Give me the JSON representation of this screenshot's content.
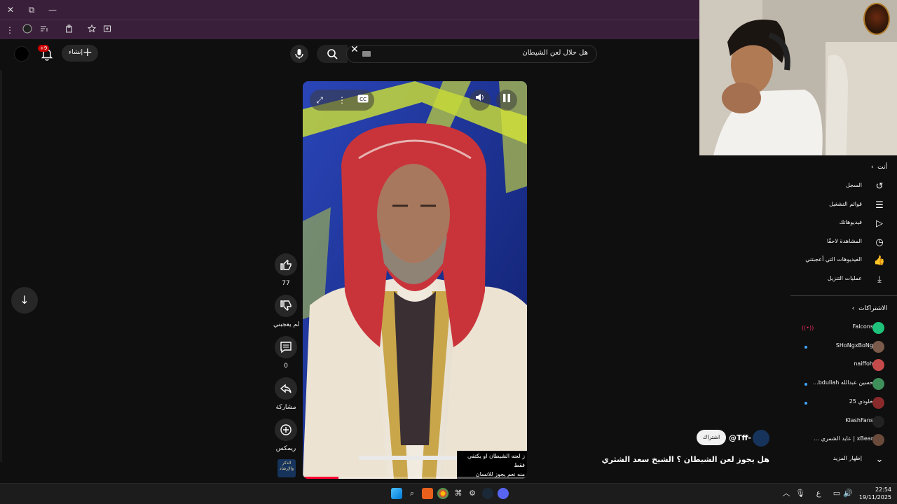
{
  "browser": {
    "close_glyph": "✕",
    "restore_glyph": "⧉",
    "minimize_glyph": "—",
    "menu_glyph": "⋮",
    "icons": [
      "close-icon",
      "restore-icon",
      "minimize-icon",
      "menu-icon",
      "profile-icon",
      "reading-list-icon",
      "extensions-icon",
      "bookmark-star-icon",
      "install-app-icon"
    ]
  },
  "header": {
    "search_query": "هل حلال لعن الشيطان",
    "create_label": "إنشاء",
    "notifications_badge": "+9"
  },
  "video": {
    "caption_lines": [
      "ز لعنه الشيطان او يكتفي فقط",
      "منه نعم يجوز للانسان"
    ],
    "progress": 0.16,
    "accent_color": "#ff0033"
  },
  "actions": {
    "likes": "77",
    "dislike_label": "لم يعجبني",
    "comments": "0",
    "share_label": "مشاركة",
    "remix_label": "ريمكس"
  },
  "channel": {
    "handle": "@Tff-",
    "subscribe_label": "اشتراك",
    "thumb_text": "الذكر والإرشاد"
  },
  "video_title": "هل يجوز لعن الشيطان ؟ الشيخ سعد الشثري",
  "sidebar": {
    "you_heading": "أنت",
    "you_items": [
      {
        "label": "السجل",
        "icon": "history-icon",
        "glyph": "↺"
      },
      {
        "label": "قوائم التشغيل",
        "icon": "playlist-icon",
        "glyph": "☰"
      },
      {
        "label": "فيديوهاتك",
        "icon": "your-videos-icon",
        "glyph": "▷"
      },
      {
        "label": "المشاهدة لاحقًا",
        "icon": "watch-later-icon",
        "glyph": "◷"
      },
      {
        "label": "الفيديوهات التي أعجبتني",
        "icon": "liked-videos-icon",
        "glyph": "👍"
      },
      {
        "label": "عمليات التنزيل",
        "icon": "downloads-icon",
        "glyph": "⤓"
      }
    ],
    "subs_heading": "الاشتراكات",
    "subs": [
      {
        "name": "Falcons",
        "color": "#1ec27a",
        "indicator": "live"
      },
      {
        "name": "SHoNgxBoNg",
        "color": "#7a5a4a",
        "indicator": "dot"
      },
      {
        "name": "naiffoh",
        "color": "#c54a4a",
        "indicator": "none"
      },
      {
        "name": "حسين عبدالله bdullah…",
        "color": "#3f8f5a",
        "indicator": "dot"
      },
      {
        "name": "خلودي 25",
        "color": "#8a2a2a",
        "indicator": "dot"
      },
      {
        "name": "KlashFans",
        "color": "#222222",
        "indicator": "none"
      },
      {
        "name": "xBear | عايد الشمري …",
        "color": "#6a4a3a",
        "indicator": "none"
      }
    ],
    "show_more": "إظهار المزيد"
  },
  "taskbar": {
    "time": "22:54",
    "date": "19/11/2025",
    "lang": "ع"
  }
}
